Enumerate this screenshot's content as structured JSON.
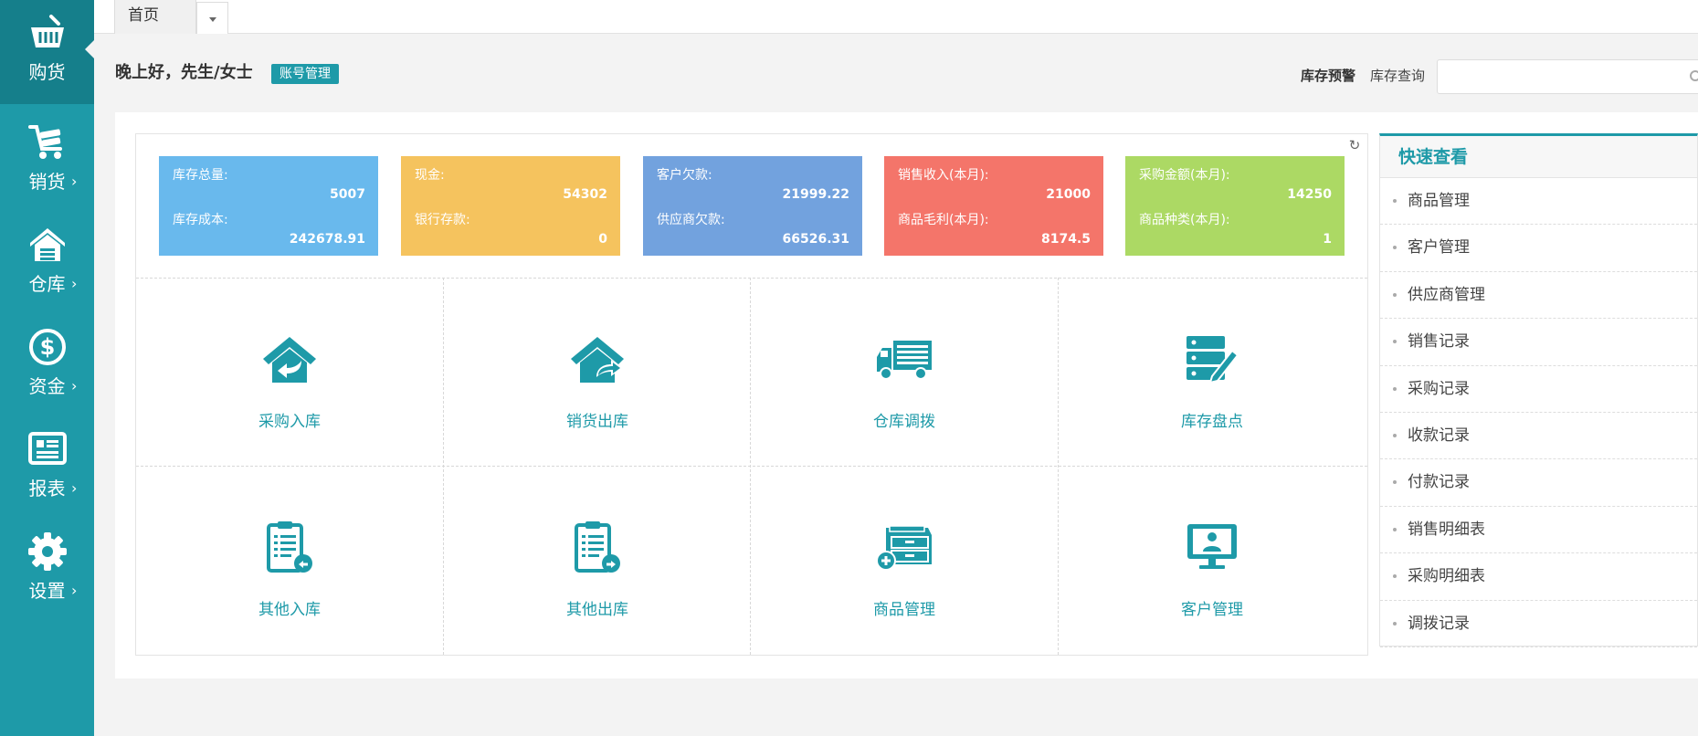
{
  "sidebar": {
    "items": [
      {
        "label": "购货",
        "icon": "basket-icon",
        "active": true,
        "arrow": ""
      },
      {
        "label": "销货",
        "icon": "cart-icon",
        "active": false,
        "arrow": "›"
      },
      {
        "label": "仓库",
        "icon": "warehouse-icon",
        "active": false,
        "arrow": "›"
      },
      {
        "label": "资金",
        "icon": "dollar-icon",
        "active": false,
        "arrow": "›"
      },
      {
        "label": "报表",
        "icon": "report-icon",
        "active": false,
        "arrow": "›"
      },
      {
        "label": "设置",
        "icon": "gear-icon",
        "active": false,
        "arrow": "›"
      }
    ]
  },
  "tabs": {
    "home": "首页"
  },
  "header": {
    "greeting": "晚上好，先生/女士",
    "account_button": "账号管理",
    "stock_warning": "库存预警",
    "stock_query_label": "库存查询",
    "stock_query_value": "",
    "stock_query_placeholder": ""
  },
  "stats": [
    {
      "label1": "库存总量:",
      "value1": "5007",
      "label2": "库存成本:",
      "value2": "242678.91",
      "color": "#69b9ed"
    },
    {
      "label1": "现金:",
      "value1": "54302",
      "label2": "银行存款:",
      "value2": "0",
      "color": "#f5c35e"
    },
    {
      "label1": "客户欠款:",
      "value1": "21999.22",
      "label2": "供应商欠款:",
      "value2": "66526.31",
      "color": "#72a2de"
    },
    {
      "label1": "销售收入(本月):",
      "value1": "21000",
      "label2": "商品毛利(本月):",
      "value2": "8174.5",
      "color": "#f4756a"
    },
    {
      "label1": "采购金额(本月):",
      "value1": "14250",
      "label2": "商品种类(本月):",
      "value2": "1",
      "color": "#acd964"
    }
  ],
  "tiles": [
    {
      "label": "采购入库",
      "icon": "house-in-icon"
    },
    {
      "label": "销货出库",
      "icon": "house-out-icon"
    },
    {
      "label": "仓库调拨",
      "icon": "truck-icon"
    },
    {
      "label": "库存盘点",
      "icon": "server-edit-icon"
    },
    {
      "label": "其他入库",
      "icon": "clipboard-in-icon"
    },
    {
      "label": "其他出库",
      "icon": "clipboard-out-icon"
    },
    {
      "label": "商品管理",
      "icon": "drawer-add-icon"
    },
    {
      "label": "客户管理",
      "icon": "monitor-user-icon"
    }
  ],
  "quick": {
    "title": "快速查看",
    "items": [
      "商品管理",
      "客户管理",
      "供应商管理",
      "销售记录",
      "采购记录",
      "收款记录",
      "付款记录",
      "销售明细表",
      "采购明细表",
      "调拨记录"
    ]
  },
  "colors": {
    "accent": "#1e9aa8",
    "sidebar_active": "#157f8b"
  }
}
